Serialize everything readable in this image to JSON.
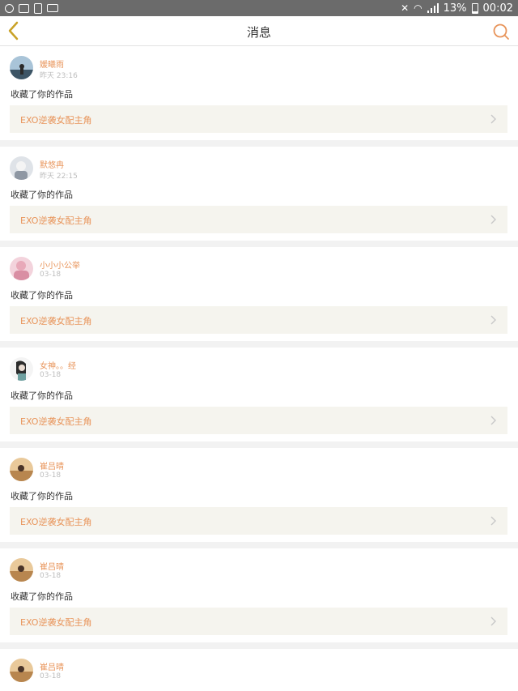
{
  "status_bar": {
    "battery_text": "13%",
    "time": "00:02",
    "icons": [
      "minus-circle-icon",
      "screen-icon",
      "clipboard-icon",
      "sim-icon",
      "mute-icon",
      "wifi-icon",
      "signal-icon",
      "battery-icon"
    ]
  },
  "header": {
    "title": "消息",
    "back_icon": "chevron-left-icon",
    "search_icon": "search-icon",
    "accent_color": "#e8945a"
  },
  "colors": {
    "accent": "#e8945a",
    "back_icon": "#c9a227",
    "work_bg": "#f5f4ee"
  },
  "messages": [
    {
      "name": "媛曦雨",
      "time": "昨天 23:16",
      "action": "收藏了你的作品",
      "work": "EXO逆袭女配主角"
    },
    {
      "name": "默悠冉",
      "time": "昨天 22:15",
      "action": "收藏了你的作品",
      "work": "EXO逆袭女配主角"
    },
    {
      "name": "小小小公举",
      "time": "03-18",
      "action": "收藏了你的作品",
      "work": "EXO逆袭女配主角"
    },
    {
      "name": "女神。。经",
      "time": "03-18",
      "action": "收藏了你的作品",
      "work": "EXO逆袭女配主角"
    },
    {
      "name": "崔吕晴",
      "time": "03-18",
      "action": "收藏了你的作品",
      "work": "EXO逆袭女配主角"
    },
    {
      "name": "崔吕晴",
      "time": "03-18",
      "action": "收藏了你的作品",
      "work": "EXO逆袭女配主角"
    },
    {
      "name": "崔吕晴",
      "time": "03-18",
      "action": "",
      "work": ""
    }
  ]
}
